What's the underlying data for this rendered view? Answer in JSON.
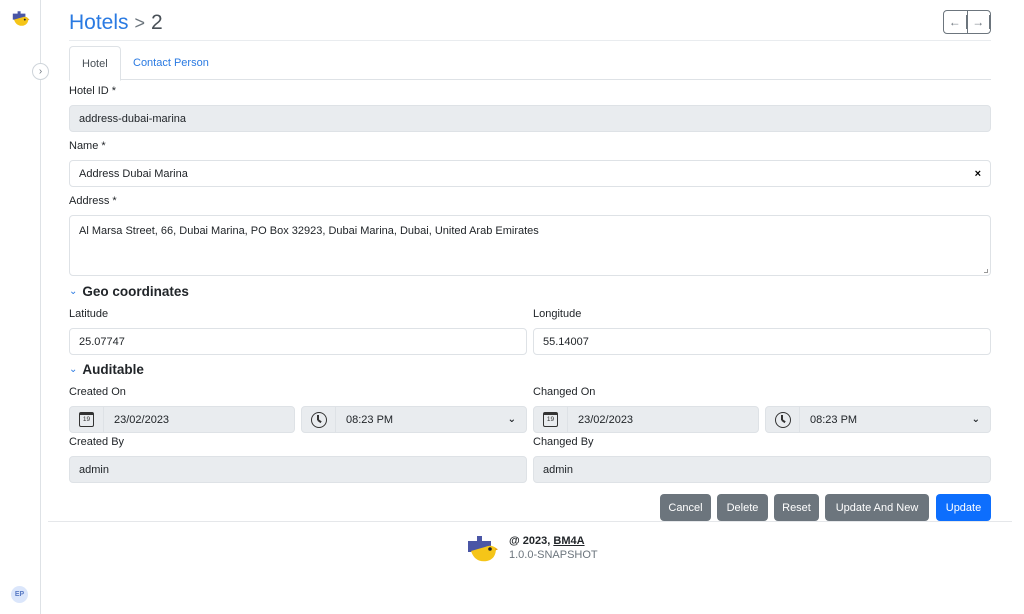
{
  "sidebar": {
    "logo_icon": "puzzle-bird-logo",
    "toggle_icon": "chevron-right",
    "avatar_initials": "EP"
  },
  "header": {
    "breadcrumb_link": "Hotels",
    "breadcrumb_separator": ">",
    "breadcrumb_current": "2",
    "prev_icon": "←",
    "next_icon": "→"
  },
  "tabs": [
    {
      "label": "Hotel",
      "active": true
    },
    {
      "label": "Contact Person",
      "active": false
    }
  ],
  "form": {
    "hotel_id": {
      "label": "Hotel ID *",
      "value": "address-dubai-marina"
    },
    "name": {
      "label": "Name *",
      "value": "Address Dubai Marina",
      "clear_icon": "×"
    },
    "address": {
      "label": "Address *",
      "value": "Al Marsa Street, 66, Dubai Marina, PO Box 32923, Dubai Marina, Dubai, United Arab Emirates"
    },
    "geo": {
      "title": "Geo coordinates",
      "latitude": {
        "label": "Latitude",
        "value": "25.07747"
      },
      "longitude": {
        "label": "Longitude",
        "value": "55.14007"
      }
    },
    "auditable": {
      "title": "Auditable",
      "created_on": {
        "label": "Created On",
        "date": "23/02/2023",
        "time": "08:23 PM",
        "calendar_day": "19"
      },
      "changed_on": {
        "label": "Changed On",
        "date": "23/02/2023",
        "time": "08:23 PM",
        "calendar_day": "19"
      },
      "created_by": {
        "label": "Created By",
        "value": "admin"
      },
      "changed_by": {
        "label": "Changed By",
        "value": "admin"
      }
    },
    "section_chevron": "⌄",
    "select_caret": "⌄"
  },
  "actions": {
    "cancel": "Cancel",
    "delete": "Delete",
    "reset": "Reset",
    "update_and_new": "Update And New",
    "update": "Update"
  },
  "footer": {
    "copyright_prefix": "@ 2023, ",
    "brand": "BM4A",
    "version": "1.0.0-SNAPSHOT"
  },
  "colors": {
    "primary": "#0d6efd",
    "secondary": "#6c757d",
    "link": "#2a7ae2",
    "readonly_bg": "#e9ecef"
  }
}
